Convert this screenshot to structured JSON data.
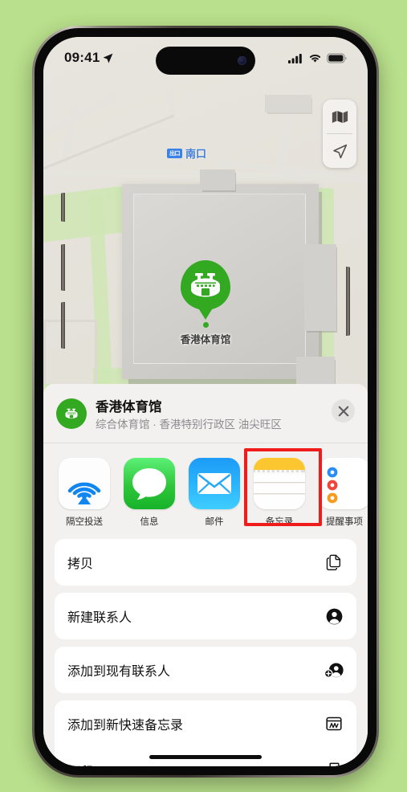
{
  "background_color": "#b9e08c",
  "status_bar": {
    "time": "09:41",
    "location_icon": "location-arrow-icon",
    "cellular_icon": "cellular-signal-icon",
    "wifi_icon": "wifi-icon",
    "battery_icon": "battery-icon"
  },
  "map": {
    "transit_label": {
      "badge": "出口",
      "name": "南口"
    },
    "poi": {
      "name": "香港体育馆",
      "pin_color": "#33a821",
      "icon": "stadium-icon"
    },
    "controls": [
      {
        "name": "map-type-button",
        "icon": "folded-map-icon"
      },
      {
        "name": "locate-me-button",
        "icon": "navigation-arrow-icon"
      }
    ]
  },
  "share_sheet": {
    "title": "香港体育馆",
    "subtitle": "综合体育馆 · 香港特别行政区 油尖旺区",
    "place_icon": "stadium-icon",
    "close_label": "✕",
    "apps": [
      {
        "label": "隔空投送",
        "icon": "airdrop-icon",
        "highlighted": false
      },
      {
        "label": "信息",
        "icon": "messages-icon",
        "highlighted": false
      },
      {
        "label": "邮件",
        "icon": "mail-icon",
        "highlighted": false
      },
      {
        "label": "备忘录",
        "icon": "notes-icon",
        "highlighted": true
      },
      {
        "label": "提醒事项",
        "icon": "reminders-icon",
        "highlighted": false
      }
    ],
    "actions": [
      {
        "label": "拷贝",
        "icon": "copy-icon"
      },
      {
        "label": "新建联系人",
        "icon": "new-contact-icon"
      },
      {
        "label": "添加到现有联系人",
        "icon": "add-to-contact-icon"
      },
      {
        "label": "添加到新快速备忘录",
        "icon": "quick-note-icon"
      },
      {
        "label": "打印",
        "icon": "printer-icon"
      }
    ]
  },
  "highlight": {
    "color": "#f01b1b",
    "target": "备忘录"
  }
}
